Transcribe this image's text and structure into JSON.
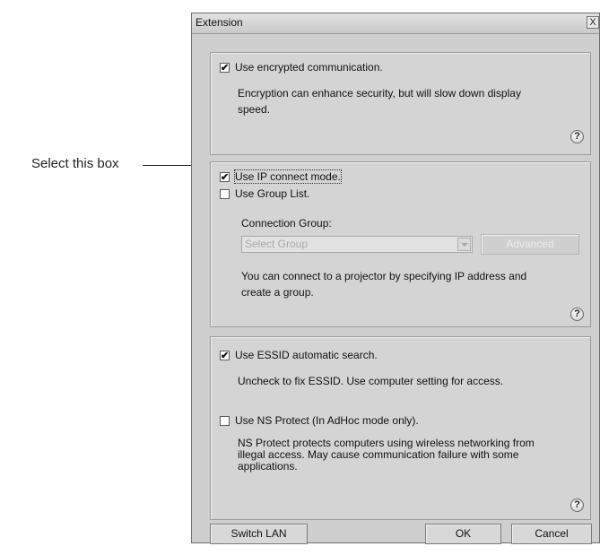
{
  "annotation": {
    "callout_text": "Select this box"
  },
  "window": {
    "title": "Extension",
    "close_glyph": "X"
  },
  "encryption": {
    "checkbox_label": "Use encrypted communication.",
    "checked": true,
    "description_line1": "Encryption can enhance security, but will slow down display",
    "description_line2": "speed."
  },
  "ip_section": {
    "ip_mode_label": "Use IP connect mode.",
    "ip_mode_checked": true,
    "group_list_label": "Use Group List.",
    "group_list_checked": false,
    "connection_group_label": "Connection Group:",
    "select_placeholder": "Select Group",
    "advanced_label": "Advanced",
    "description_line1": "You can connect to a projector by specifying IP address and",
    "description_line2": "create a group."
  },
  "network_section": {
    "essid_label": "Use ESSID automatic search.",
    "essid_checked": true,
    "essid_description": "Uncheck to fix ESSID. Use computer setting for access.",
    "ns_label": "Use NS Protect (In AdHoc mode only).",
    "ns_checked": false,
    "ns_description_line1": "NS Protect protects computers using wireless networking from",
    "ns_description_line2": "illegal access. May cause communication failure with some",
    "ns_description_line3": "applications."
  },
  "help_glyph": "?",
  "check_glyph": "✔",
  "footer": {
    "switch_lan_label": "Switch LAN",
    "ok_label": "OK",
    "cancel_label": "Cancel"
  }
}
